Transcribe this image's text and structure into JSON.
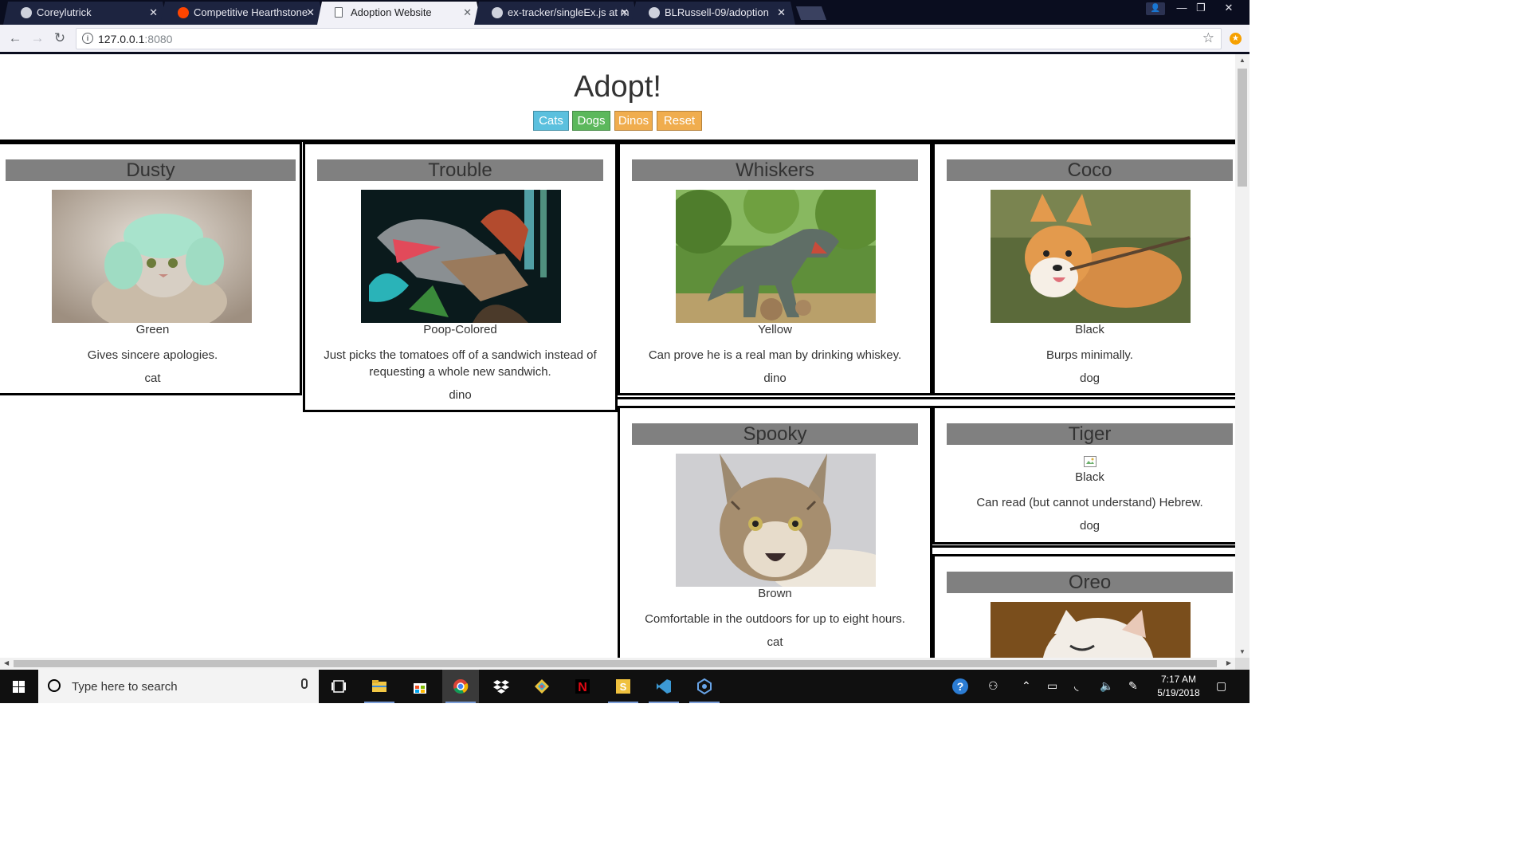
{
  "browser": {
    "tabs": [
      {
        "title": "Coreylutrick"
      },
      {
        "title": "Competitive Hearthstone"
      },
      {
        "title": "Adoption Website"
      },
      {
        "title": "ex-tracker/singleEx.js at m"
      },
      {
        "title": "BLRussell-09/adoption"
      }
    ],
    "url_host": "127.0.0.1",
    "url_port": ":8080"
  },
  "page": {
    "title": "Adopt!",
    "filters": {
      "cats": "Cats",
      "dogs": "Dogs",
      "dinos": "Dinos",
      "reset": "Reset"
    },
    "pets": [
      {
        "name": "Dusty",
        "color": "Green",
        "skill": "Gives sincere apologies.",
        "type": "cat"
      },
      {
        "name": "Trouble",
        "color": "Poop-Colored",
        "skill": "Just picks the tomatoes off of a sandwich instead of requesting a whole new sandwich.",
        "type": "dino"
      },
      {
        "name": "Whiskers",
        "color": "Yellow",
        "skill": "Can prove he is a real man by drinking whiskey.",
        "type": "dino"
      },
      {
        "name": "Coco",
        "color": "Black",
        "skill": "Burps minimally.",
        "type": "dog"
      },
      {
        "name": "Spooky",
        "color": "Brown",
        "skill": "Comfortable in the outdoors for up to eight hours.",
        "type": "cat"
      },
      {
        "name": "Tiger",
        "color": "Black",
        "skill": "Can read (but cannot understand) Hebrew.",
        "type": "dog"
      },
      {
        "name": "Oreo"
      }
    ],
    "colors": {
      "cats_btn": "#5bc0de",
      "dogs_btn": "#5cb85c",
      "dinos_btn": "#f0ad4e",
      "name_bar": "#808080"
    }
  },
  "taskbar": {
    "search_placeholder": "Type here to search",
    "time": "7:17 AM",
    "date": "5/19/2018"
  }
}
